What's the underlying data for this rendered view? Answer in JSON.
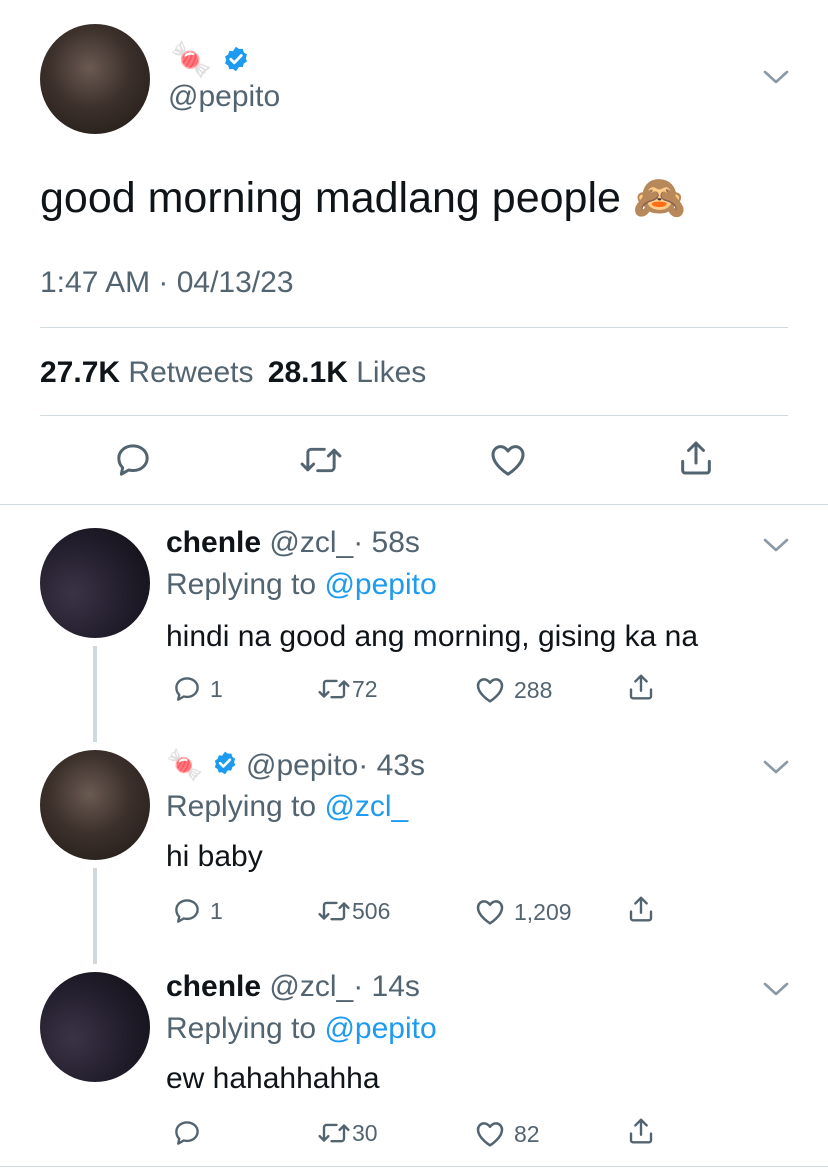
{
  "main_tweet": {
    "name_emoji": "🍬",
    "handle": "@pepito",
    "text": "good morning madlang people 🙈",
    "timestamp": "1:47 AM · 04/13/23",
    "retweets_count": "27.7K",
    "retweets_label": "Retweets",
    "likes_count": "28.1K",
    "likes_label": "Likes"
  },
  "replies": [
    {
      "name": "chenle",
      "handle": "@zcl_",
      "time": "· 58s",
      "replying_prefix": "Replying to",
      "replying_to": "@pepito",
      "text": "hindi na good ang morning, gising ka na",
      "replies": "1",
      "retweets": "72",
      "likes": "288"
    },
    {
      "name_emoji": "🍬",
      "handle": "@pepito",
      "time": "· 43s",
      "replying_prefix": "Replying to",
      "replying_to": "@zcl_",
      "text": "hi baby",
      "replies": "1",
      "retweets": "506",
      "likes": "1,209"
    },
    {
      "name": "chenle",
      "handle": "@zcl_",
      "time": "· 14s",
      "replying_prefix": "Replying to",
      "replying_to": "@pepito",
      "text": "ew hahahhahha",
      "replies": "",
      "retweets": "30",
      "likes": "82"
    }
  ],
  "colors": {
    "link_blue": "#1d9bf0",
    "muted": "#536471",
    "divider": "#cfd9de"
  },
  "icons": [
    "verified-icon",
    "chevron-down-icon",
    "reply-icon",
    "retweet-icon",
    "like-icon",
    "share-icon"
  ]
}
